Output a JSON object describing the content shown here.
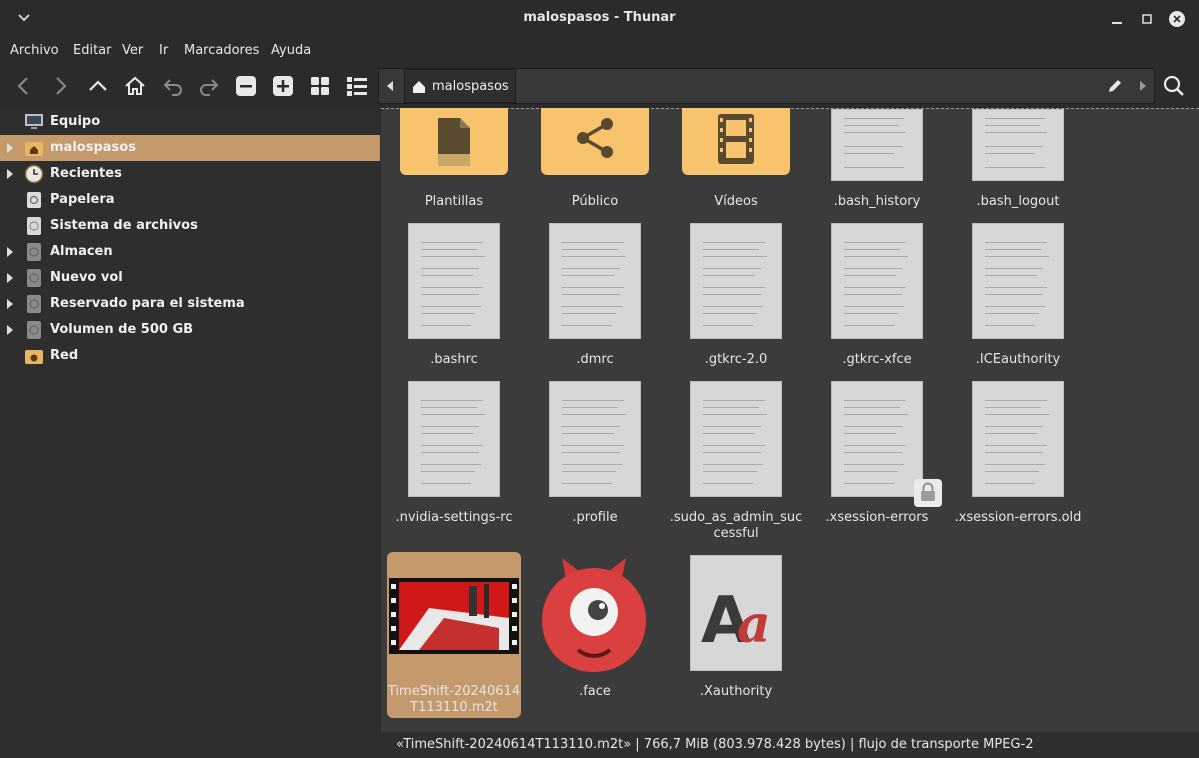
{
  "window": {
    "title": "malospasos - Thunar"
  },
  "menu": [
    "Archivo",
    "Editar",
    "Ver",
    "Ir",
    "Marcadores",
    "Ayuda"
  ],
  "location": {
    "current": "malospasos"
  },
  "sidebar": {
    "items": [
      {
        "label": "Equipo",
        "icon": "computer-icon"
      },
      {
        "label": "malospasos",
        "icon": "home-folder-icon"
      },
      {
        "label": "Recientes",
        "icon": "clock-icon"
      },
      {
        "label": "Papelera",
        "icon": "trash-icon"
      },
      {
        "label": "Sistema de archivos",
        "icon": "drive-icon"
      },
      {
        "label": "Almacen",
        "icon": "drive-icon"
      },
      {
        "label": "Nuevo vol",
        "icon": "drive-icon"
      },
      {
        "label": "Reservado para el sistema",
        "icon": "drive-icon"
      },
      {
        "label": "Volumen de 500 GB",
        "icon": "drive-icon"
      },
      {
        "label": "Red",
        "icon": "network-folder-icon"
      }
    ]
  },
  "files": [
    {
      "name": "Plantillas"
    },
    {
      "name": "Público"
    },
    {
      "name": "Vídeos"
    },
    {
      "name": ".bash_history"
    },
    {
      "name": ".bash_logout"
    },
    {
      "name": ".bashrc"
    },
    {
      "name": ".dmrc"
    },
    {
      "name": ".gtkrc-2.0"
    },
    {
      "name": ".gtkrc-xfce"
    },
    {
      "name": ".ICEauthority"
    },
    {
      "name": ".nvidia-settings-rc"
    },
    {
      "name": ".profile"
    },
    {
      "name": ".sudo_as_admin_successful",
      "display": ".sudo_as_admin_suc cessful"
    },
    {
      "name": ".xsession-errors"
    },
    {
      "name": ".xsession-errors.old"
    },
    {
      "name": "TimeShift-20240614T113110.m2t",
      "display": "TimeShift-20240614 T113110.m2t"
    },
    {
      "name": ".face"
    },
    {
      "name": ".Xauthority"
    }
  ],
  "status": {
    "text": "«TimeShift-20240614T113110.m2t»  |  766,7 MiB (803.978.428 bytes)  |  flujo de transporte MPEG-2"
  },
  "colors": {
    "accent": "#c49a6c",
    "folder": "#f7c36d",
    "sidebar_bg": "#2e2e2e",
    "view_bg": "#3b3b3b"
  }
}
